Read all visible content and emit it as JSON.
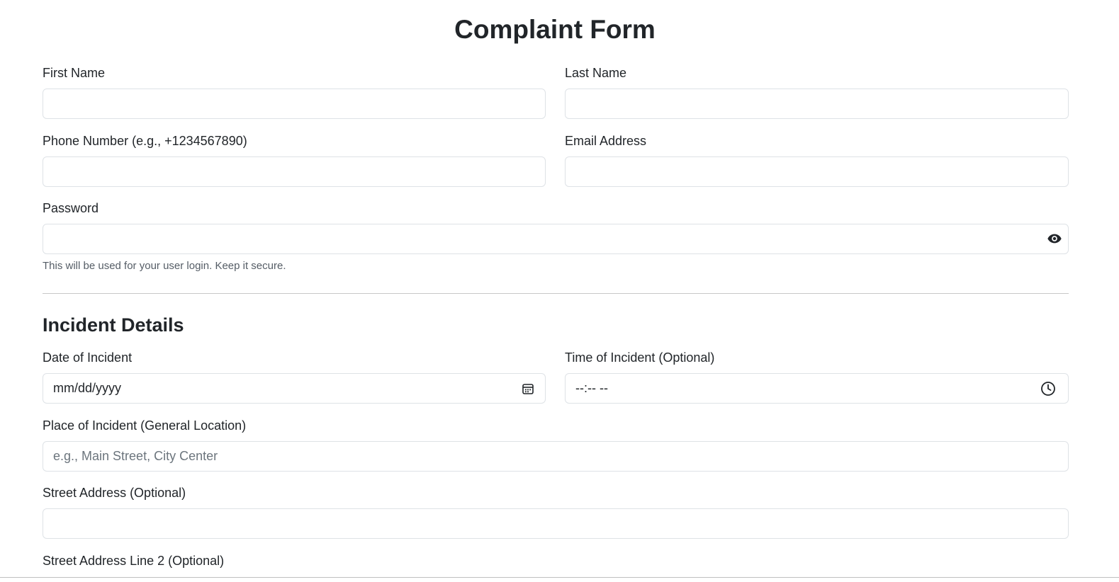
{
  "form": {
    "title": "Complaint Form",
    "first_name": {
      "label": "First Name",
      "value": ""
    },
    "last_name": {
      "label": "Last Name",
      "value": ""
    },
    "phone": {
      "label": "Phone Number (e.g., +1234567890)",
      "value": ""
    },
    "email": {
      "label": "Email Address",
      "value": ""
    },
    "password": {
      "label": "Password",
      "value": "",
      "help": "This will be used for your user login. Keep it secure.",
      "toggle_icon": "eye-icon"
    }
  },
  "incident": {
    "title": "Incident Details",
    "date": {
      "label": "Date of Incident",
      "display": "mm/dd/yyyy",
      "icon": "calendar-icon"
    },
    "time": {
      "label": "Time of Incident (Optional)",
      "display": "--:-- --",
      "icon": "clock-icon"
    },
    "place": {
      "label": "Place of Incident (General Location)",
      "placeholder": "e.g., Main Street, City Center",
      "value": ""
    },
    "street": {
      "label": "Street Address (Optional)",
      "value": ""
    },
    "street2": {
      "label": "Street Address Line 2 (Optional)"
    }
  },
  "colors": {
    "text": "#212529",
    "border": "#dee2e6",
    "muted": "#6c757d",
    "divider": "#c8c8c8"
  }
}
